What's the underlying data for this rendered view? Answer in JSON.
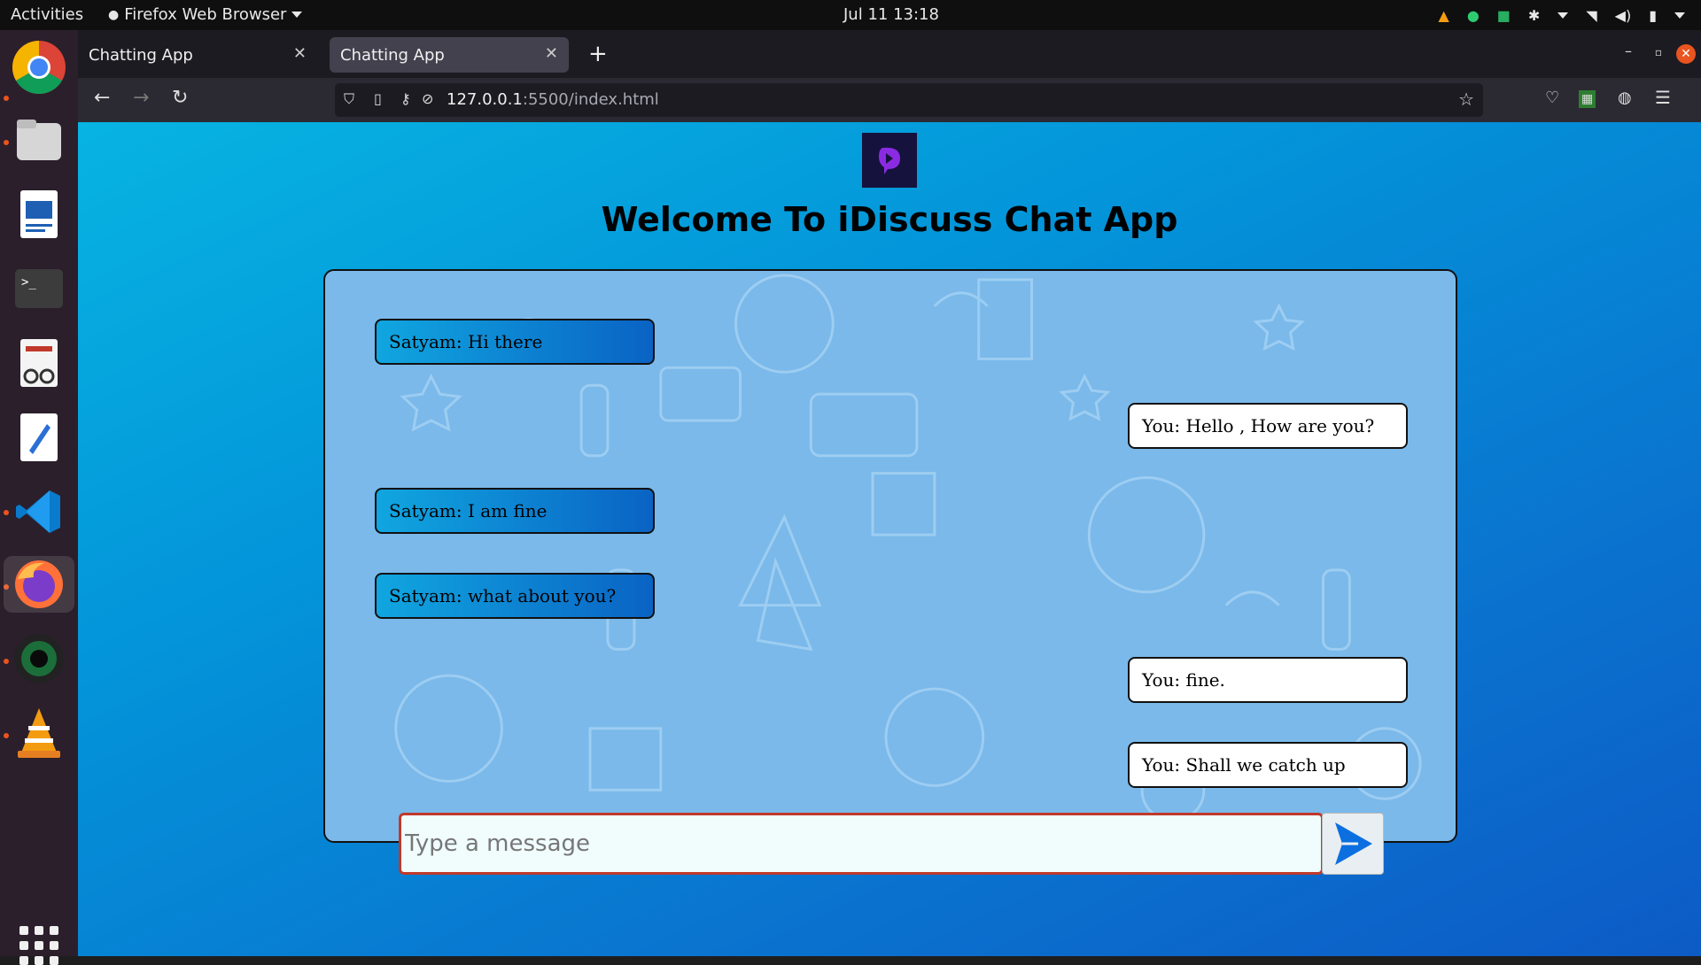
{
  "system": {
    "activities": "Activities",
    "app_menu": "Firefox Web Browser",
    "clock": "Jul 11  13:18"
  },
  "browser": {
    "tabs": [
      {
        "title": "Chatting App",
        "selected": false
      },
      {
        "title": "Chatting App",
        "selected": true
      }
    ],
    "url_host": "127.0.0.1",
    "url_rest": ":5500/index.html"
  },
  "page": {
    "title": "Welcome To iDiscuss Chat App",
    "messages": [
      {
        "side": "left",
        "text": "Satyam: Hi there"
      },
      {
        "side": "right",
        "text": "You: Hello , How are you?"
      },
      {
        "side": "left",
        "text": "Satyam: I am fine"
      },
      {
        "side": "left",
        "text": "Satyam: what about you?"
      },
      {
        "side": "right",
        "text": "You: fine."
      },
      {
        "side": "right",
        "text": "You: Shall we catch up"
      }
    ],
    "composer_placeholder": "Type a message"
  },
  "colors": {
    "page_gradient_start": "#07b4e2",
    "page_gradient_end": "#0d5bc6",
    "chat_bg": "#7ab9ea",
    "incoming_bubble": "#0a63c4",
    "outgoing_bubble": "#ffffff",
    "send_arrow": "#0b6fe0"
  },
  "icons": [
    "chrome-icon",
    "files-icon",
    "writer-icon",
    "terminal-icon",
    "reader-icon",
    "text-editor-icon",
    "vscode-icon",
    "firefox-icon",
    "camera-icon",
    "vlc-icon",
    "apps-grid-icon"
  ]
}
